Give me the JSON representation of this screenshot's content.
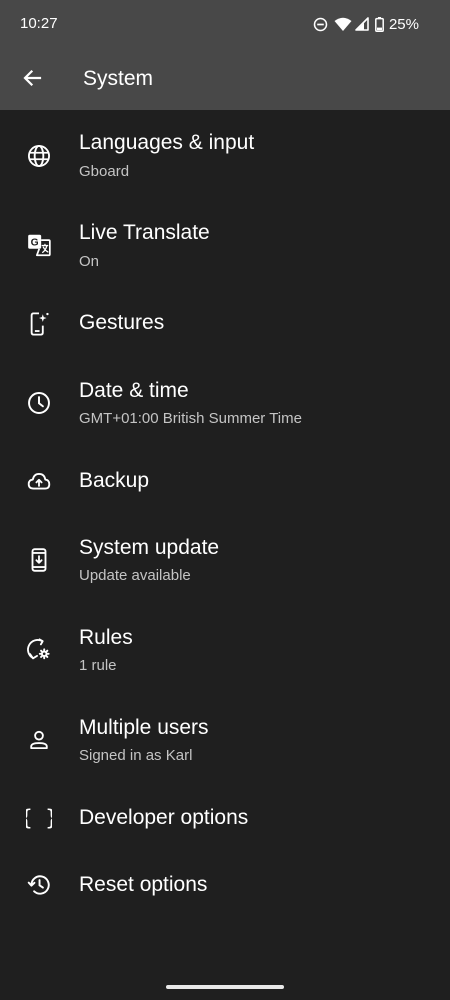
{
  "status_bar": {
    "time": "10:27",
    "battery_percent": "25%",
    "icons": [
      "do-not-disturb-icon",
      "wifi-icon",
      "cell-signal-icon",
      "battery-icon"
    ]
  },
  "app_bar": {
    "title": "System",
    "back_icon": "arrow-back-icon"
  },
  "settings": [
    {
      "title": "Languages & input",
      "summary": "Gboard",
      "icon": "globe-icon"
    },
    {
      "title": "Live Translate",
      "summary": "On",
      "icon": "translate-icon"
    },
    {
      "title": "Gestures",
      "summary": "",
      "icon": "gesture-phone-icon"
    },
    {
      "title": "Date & time",
      "summary": "GMT+01:00 British Summer Time",
      "icon": "clock-icon"
    },
    {
      "title": "Backup",
      "summary": "",
      "icon": "cloud-upload-icon"
    },
    {
      "title": "System update",
      "summary": "Update available",
      "icon": "system-update-icon"
    },
    {
      "title": "Rules",
      "summary": "1 rule",
      "icon": "rules-icon"
    },
    {
      "title": "Multiple users",
      "summary": "Signed in as Karl",
      "icon": "person-icon"
    },
    {
      "title": "Developer options",
      "summary": "",
      "icon": "braces-icon"
    },
    {
      "title": "Reset options",
      "summary": "",
      "icon": "history-icon"
    }
  ],
  "colors": {
    "background": "#1f1f1f",
    "app_bar": "#484848",
    "text_primary": "#ffffff",
    "text_secondary": "#c4c4c4"
  }
}
